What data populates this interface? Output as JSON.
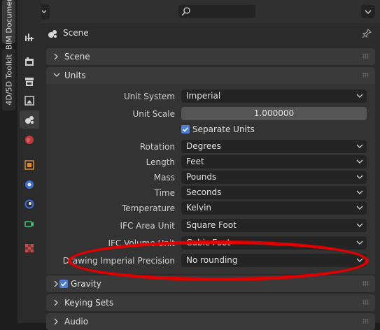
{
  "tabs": [
    "BIM Document",
    "4D/5D Toolkit"
  ],
  "context_title": "Scene",
  "panels": {
    "scene": "Scene",
    "units": "Units",
    "gravity": "Gravity",
    "keying_sets": "Keying Sets",
    "audio": "Audio"
  },
  "units": {
    "unit_system": {
      "label": "Unit System",
      "value": "Imperial"
    },
    "unit_scale": {
      "label": "Unit Scale",
      "value": "1.000000"
    },
    "separate_units": {
      "label": "Separate Units",
      "checked": true
    },
    "rotation": {
      "label": "Rotation",
      "value": "Degrees"
    },
    "length": {
      "label": "Length",
      "value": "Feet"
    },
    "mass": {
      "label": "Mass",
      "value": "Pounds"
    },
    "time": {
      "label": "Time",
      "value": "Seconds"
    },
    "temperature": {
      "label": "Temperature",
      "value": "Kelvin"
    },
    "ifc_area_unit": {
      "label": "IFC Area Unit",
      "value": "Square Foot"
    },
    "ifc_volume_unit": {
      "label": "IFC Volume Unit",
      "value": "Cubic Foot"
    },
    "drawing_imperial_precision": {
      "label": "Drawing Imperial Precision",
      "value": "No rounding"
    }
  },
  "gravity_enabled": true,
  "colors": {
    "accent": "#4a7fd4",
    "annotation": "#e00000"
  },
  "icons": [
    "editor-type-icon",
    "search-icon",
    "tool-icon",
    "render-icon",
    "output-icon",
    "view-layer-icon",
    "scene-icon",
    "world-icon",
    "object-icon",
    "modifier-icon",
    "particles-icon",
    "physics-icon",
    "texture-icon",
    "pin-icon"
  ]
}
